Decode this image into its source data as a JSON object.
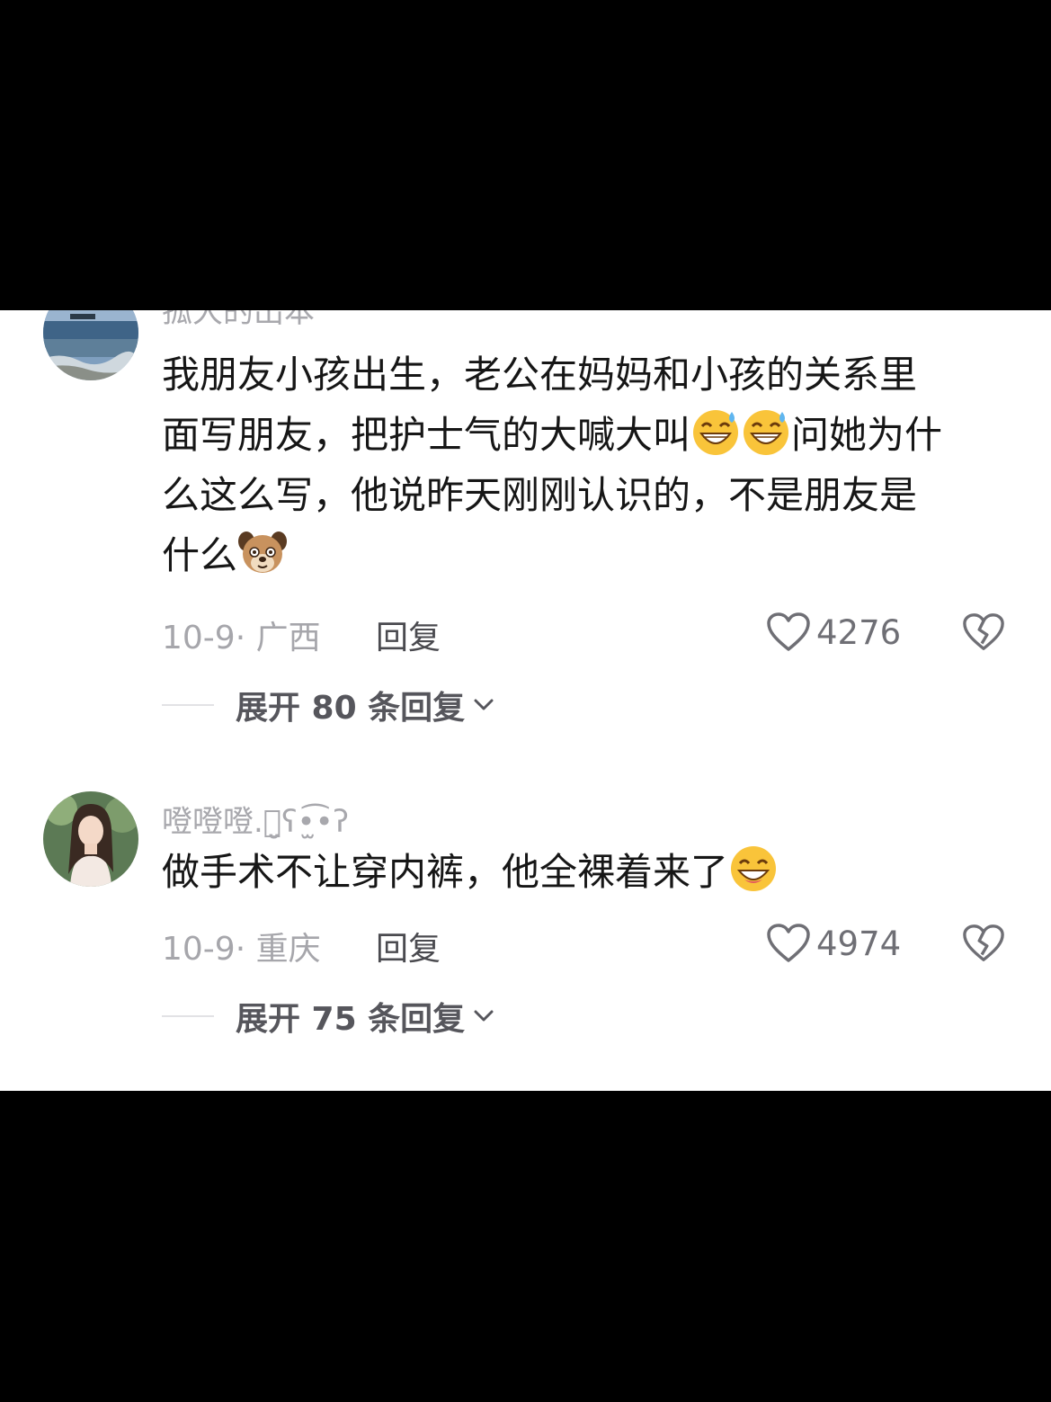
{
  "comments": [
    {
      "username": "孤大的出本",
      "body_lines": [
        "我朋友小孩出生，老公在妈妈和小孩的关系里",
        "面写朋友，把护士气的大喊大叫",
        "问她为什",
        "么这么写，他说昨天刚刚认识的，不是朋友是",
        "什么"
      ],
      "emojis": [
        "sweat-grin-emoji",
        "sweat-grin-emoji",
        "puppy-face-emoji"
      ],
      "date": "10-9·",
      "location": "广西",
      "reply_label": "回复",
      "likes": "4276",
      "expand_label": "展开 80 条回复"
    },
    {
      "username": "噔噔噔.ꪔ̤̮ʕ•̫͡•ʔ",
      "body_lines": [
        "做手术不让穿内裤，他全裸着来了"
      ],
      "emojis": [
        "grinning-face-emoji"
      ],
      "date": "10-9·",
      "location": "重庆",
      "reply_label": "回复",
      "likes": "4974",
      "expand_label": "展开 75 条回复"
    }
  ],
  "colors": {
    "background": "#ffffff",
    "letterbox": "#000000",
    "text_primary": "#161616",
    "text_secondary": "#a6a6ab"
  }
}
